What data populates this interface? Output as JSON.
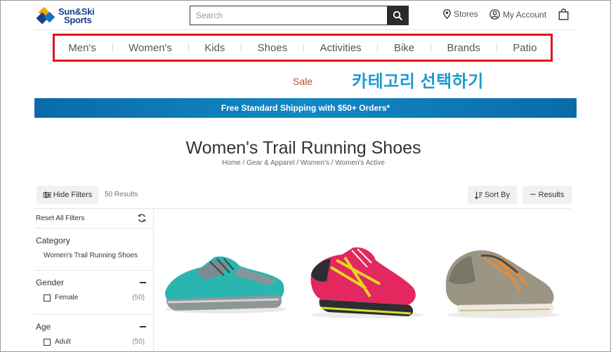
{
  "header": {
    "logo_line1": "Sun&Ski",
    "logo_line2": "Sports",
    "search_placeholder": "Search",
    "stores_label": "Stores",
    "account_label": "My Account"
  },
  "nav": {
    "items": [
      "Men's",
      "Women's",
      "Kids",
      "Shoes",
      "Activities",
      "Bike",
      "Brands",
      "Patio"
    ],
    "sale_label": "Sale"
  },
  "annotation": "카테고리 선택하기",
  "banner": "Free Standard Shipping with $50+ Orders*",
  "page": {
    "title": "Women's Trail Running Shoes",
    "breadcrumb": "Home / Gear & Apparel / Women's / Women's Active"
  },
  "toolbar": {
    "hide_filters": "Hide Filters",
    "results_count": "50 Results",
    "sort_by": "Sort By",
    "results": "Results"
  },
  "filters": {
    "reset": "Reset All Filters",
    "category_title": "Category",
    "category_value": "Women's Trail Running Shoes",
    "gender_title": "Gender",
    "gender_option": "Female",
    "gender_count": "(50)",
    "age_title": "Age",
    "age_option": "Adult",
    "age_count": "(50)"
  },
  "colors": {
    "brand_blue": "#1a3e8c",
    "highlight_red": "#e0141e",
    "annotation_blue": "#1b9ad1",
    "banner_blue": "#1388c6",
    "sale_red": "#c0463f"
  }
}
